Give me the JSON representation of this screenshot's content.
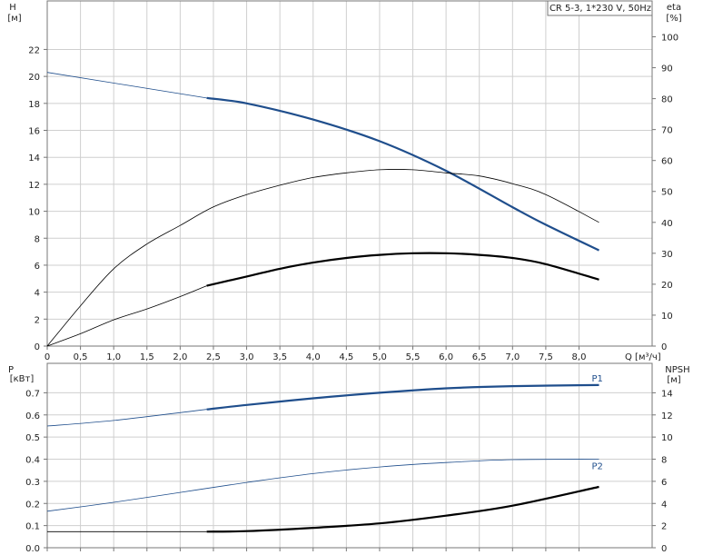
{
  "title_box": "CR 5-3, 1*230 V, 50Hz",
  "colors": {
    "blue": "#1f4e8c",
    "black": "#000000",
    "grid": "#cfcfcf",
    "frame": "#777777"
  },
  "chart_data": [
    {
      "type": "line",
      "title": "CR 5-3, 1*230 V, 50Hz",
      "xlabel": "Q [м³/ч]",
      "ylabel_left": [
        "H",
        "[м]"
      ],
      "ylabel_right": [
        "eta",
        "[%]"
      ],
      "xlim": [
        0,
        9.1
      ],
      "ylim_left": [
        0,
        25.6
      ],
      "ylim_right": [
        0,
        111.6
      ],
      "x_ticks": [
        "0",
        "0,5",
        "1,0",
        "1,5",
        "2,0",
        "2,5",
        "3,0",
        "3,5",
        "4,0",
        "4,5",
        "5,0",
        "5,5",
        "6,0",
        "6,5",
        "7,0",
        "7,5",
        "8,0"
      ],
      "y_ticks_left": [
        "0",
        "2",
        "4",
        "6",
        "8",
        "10",
        "12",
        "14",
        "16",
        "18",
        "20",
        "22"
      ],
      "y_ticks_right": [
        "0",
        "10",
        "20",
        "30",
        "40",
        "50",
        "60",
        "70",
        "80",
        "90",
        "100"
      ],
      "grid": true,
      "series": [
        {
          "axis": "left",
          "color": "#1f4e8c",
          "bold_from": 2.4,
          "points": [
            [
              0,
              20.3
            ],
            [
              2.4,
              18.4
            ],
            [
              3.0,
              18.0
            ],
            [
              4.0,
              16.8
            ],
            [
              5.0,
              15.2
            ],
            [
              6.0,
              13.0
            ],
            [
              7.0,
              10.3
            ],
            [
              7.5,
              9.0
            ],
            [
              8.3,
              7.1
            ]
          ]
        },
        {
          "axis": "right",
          "color": "#000000",
          "bold_from": 99,
          "points": [
            [
              0,
              0
            ],
            [
              0.5,
              13
            ],
            [
              1.0,
              25
            ],
            [
              1.5,
              33
            ],
            [
              2.0,
              39
            ],
            [
              2.5,
              45
            ],
            [
              3.0,
              49
            ],
            [
              3.5,
              52
            ],
            [
              4.0,
              54.5
            ],
            [
              4.5,
              56
            ],
            [
              5.0,
              57
            ],
            [
              5.5,
              57
            ],
            [
              6.0,
              56
            ],
            [
              6.5,
              55
            ],
            [
              7.0,
              52.5
            ],
            [
              7.5,
              49
            ],
            [
              8.3,
              40
            ]
          ]
        },
        {
          "axis": "right",
          "color": "#000000",
          "bold_from": 2.4,
          "points": [
            [
              0,
              0
            ],
            [
              0.5,
              4
            ],
            [
              1.0,
              8.5
            ],
            [
              1.5,
              12
            ],
            [
              2.0,
              16
            ],
            [
              2.4,
              19.5
            ],
            [
              3.0,
              22.5
            ],
            [
              3.5,
              25
            ],
            [
              4.0,
              27
            ],
            [
              4.5,
              28.5
            ],
            [
              5.0,
              29.5
            ],
            [
              5.5,
              30
            ],
            [
              6.0,
              30
            ],
            [
              6.5,
              29.5
            ],
            [
              7.0,
              28.5
            ],
            [
              7.5,
              26.5
            ],
            [
              8.3,
              21.5
            ]
          ]
        }
      ]
    },
    {
      "type": "line",
      "xlabel": "",
      "ylabel_left": [
        "P",
        "[кВт]"
      ],
      "ylabel_right": [
        "NPSH",
        "[м]"
      ],
      "xlim": [
        0,
        9.1
      ],
      "ylim_left": [
        0,
        0.833
      ],
      "ylim_right": [
        0,
        16.66
      ],
      "y_ticks_left": [
        "0.0",
        "0.1",
        "0.2",
        "0.3",
        "0.4",
        "0.5",
        "0.6",
        "0.7"
      ],
      "y_ticks_right": [
        "0",
        "2",
        "4",
        "6",
        "8",
        "10",
        "12",
        "14"
      ],
      "grid": true,
      "series": [
        {
          "name": "P1",
          "axis": "left",
          "color": "#1f4e8c",
          "bold_from": 2.4,
          "points": [
            [
              0,
              0.55
            ],
            [
              1.0,
              0.575
            ],
            [
              2.4,
              0.625
            ],
            [
              3.0,
              0.645
            ],
            [
              4.0,
              0.675
            ],
            [
              5.0,
              0.7
            ],
            [
              6.0,
              0.72
            ],
            [
              7.0,
              0.73
            ],
            [
              8.3,
              0.735
            ]
          ]
        },
        {
          "name": "P2",
          "axis": "left",
          "color": "#1f4e8c",
          "bold_from": 99,
          "points": [
            [
              0,
              0.165
            ],
            [
              1.0,
              0.205
            ],
            [
              2.0,
              0.25
            ],
            [
              3.0,
              0.295
            ],
            [
              4.0,
              0.335
            ],
            [
              5.0,
              0.365
            ],
            [
              6.0,
              0.385
            ],
            [
              7.0,
              0.398
            ],
            [
              8.3,
              0.4
            ]
          ]
        },
        {
          "name": "",
          "axis": "right",
          "color": "#000000",
          "bold_from": 2.4,
          "points": [
            [
              0,
              1.45
            ],
            [
              2.4,
              1.45
            ],
            [
              3.0,
              1.5
            ],
            [
              4.0,
              1.8
            ],
            [
              5.0,
              2.2
            ],
            [
              6.0,
              2.9
            ],
            [
              7.0,
              3.8
            ],
            [
              8.3,
              5.5
            ]
          ]
        }
      ]
    }
  ]
}
